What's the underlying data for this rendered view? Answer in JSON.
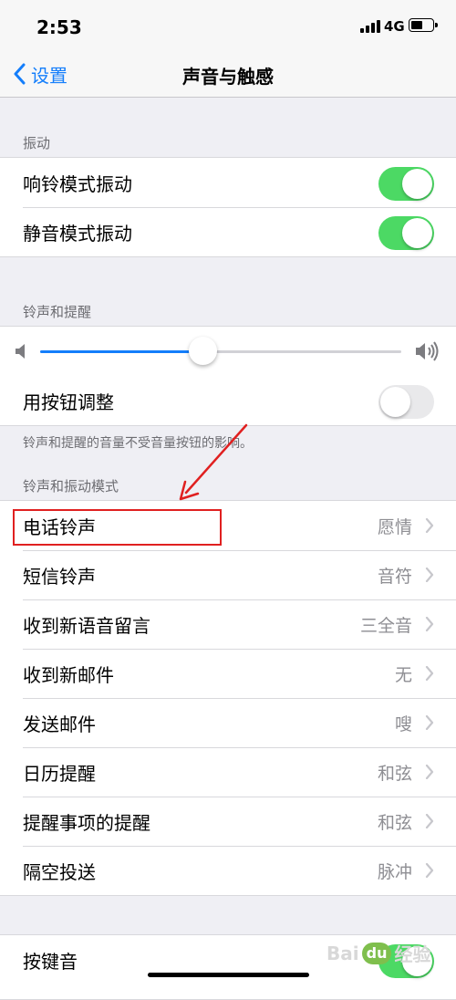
{
  "status_bar": {
    "time": "2:53",
    "network": "4G"
  },
  "nav": {
    "back_label": "设置",
    "title": "声音与触感"
  },
  "vibration": {
    "header": "振动",
    "rows": [
      {
        "label": "响铃模式振动",
        "toggle": "on"
      },
      {
        "label": "静音模式振动",
        "toggle": "on"
      }
    ]
  },
  "ringer": {
    "header": "铃声和提醒",
    "volume_level": 0.45,
    "adjust_with_buttons": {
      "label": "用按钮调整",
      "toggle": "off"
    },
    "footer": "铃声和提醒的音量不受音量按钮的影响。"
  },
  "sounds": {
    "header": "铃声和振动模式",
    "rows": [
      {
        "label": "电话铃声",
        "value": "愿情"
      },
      {
        "label": "短信铃声",
        "value": "音符"
      },
      {
        "label": "收到新语音留言",
        "value": "三全音"
      },
      {
        "label": "收到新邮件",
        "value": "无"
      },
      {
        "label": "发送邮件",
        "value": "嗖"
      },
      {
        "label": "日历提醒",
        "value": "和弦"
      },
      {
        "label": "提醒事项的提醒",
        "value": "和弦"
      },
      {
        "label": "隔空投送",
        "value": "脉冲"
      }
    ]
  },
  "keyboard": {
    "label": "按键音"
  },
  "watermark": {
    "left": "Bai",
    "mid": "du",
    "right": "经验"
  },
  "colors": {
    "accent": "#147efb",
    "toggle_on": "#4cd964",
    "annotation": "#e02020"
  }
}
